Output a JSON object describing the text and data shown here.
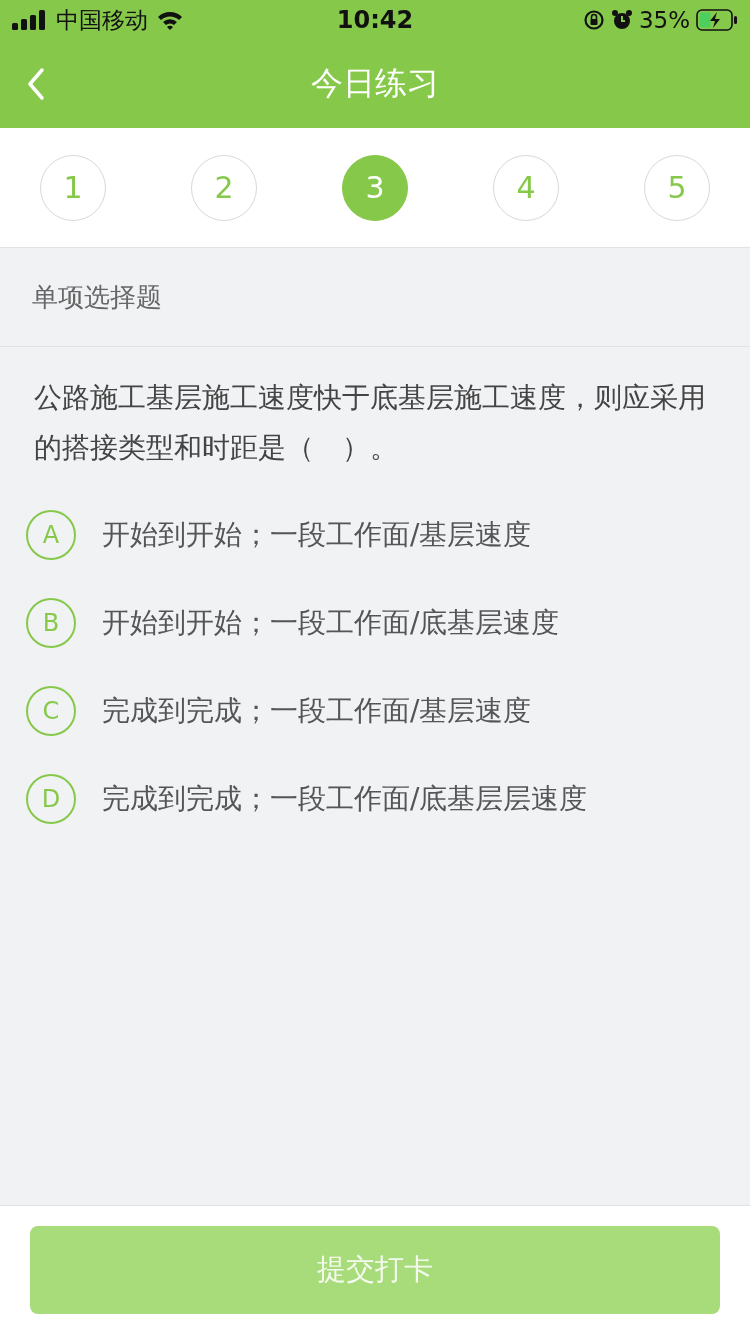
{
  "status_bar": {
    "carrier": "中国移动",
    "time": "10:42",
    "battery": "35%"
  },
  "nav": {
    "title": "今日练习"
  },
  "steps": [
    {
      "label": "1",
      "selected": false
    },
    {
      "label": "2",
      "selected": false
    },
    {
      "label": "3",
      "selected": true
    },
    {
      "label": "4",
      "selected": false
    },
    {
      "label": "5",
      "selected": false
    }
  ],
  "question": {
    "type": "单项选择题",
    "text": "公路施工基层施工速度快于底基层施工速度，则应采用的搭接类型和时距是（　）。",
    "options": [
      {
        "letter": "A",
        "text": "开始到开始；一段工作面/基层速度",
        "selected": false
      },
      {
        "letter": "B",
        "text": "开始到开始；一段工作面/底基层速度",
        "selected": false
      },
      {
        "letter": "C",
        "text": "完成到完成；一段工作面/基层速度",
        "selected": false
      },
      {
        "letter": "D",
        "text": "完成到完成；一段工作面/底基层层速度",
        "selected": false
      }
    ]
  },
  "submit": {
    "label": "提交打卡",
    "disabled": true
  }
}
